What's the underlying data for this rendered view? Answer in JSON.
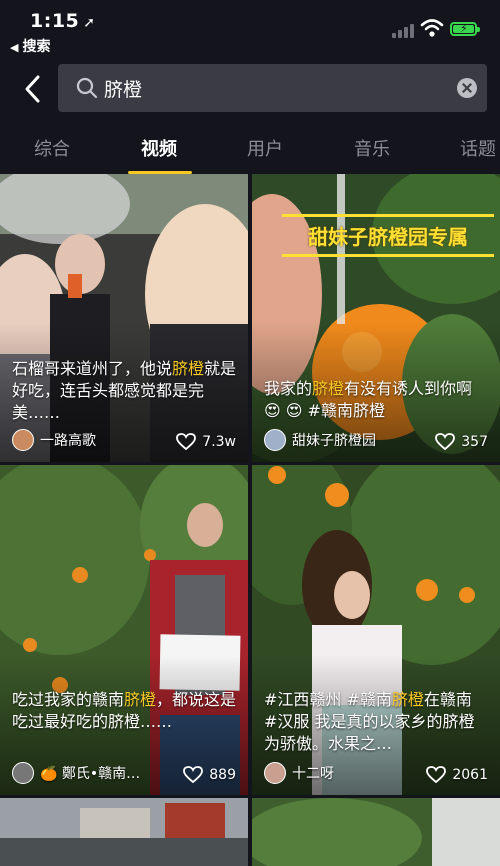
{
  "status": {
    "time": "1:15",
    "back_app": "搜索"
  },
  "search": {
    "query": "脐橙"
  },
  "tabs": [
    "综合",
    "视频",
    "用户",
    "音乐",
    "话题"
  ],
  "active_tab": "视频",
  "videos": [
    {
      "caption_pre": "石榴哥来道州了，他说",
      "caption_hl1": "脐",
      "caption_mid": "",
      "caption_hl2": "橙",
      "caption_post": "就是好吃，连舌头都感觉都是完美……",
      "author": "一路高歌",
      "likes": "7.3w"
    },
    {
      "overlay": "甜妹子脐橙园专属",
      "caption_pre": "我家的",
      "caption_hl1": "脐橙",
      "caption_post": "有没有诱人到你啊 😍 😍 #赣南脐橙",
      "author": "甜妹子脐橙园",
      "likes": "357"
    },
    {
      "caption_pre": "吃过我家的赣南",
      "caption_hl1": "脐橙",
      "caption_post": "，都说这是吃过最好吃的脐橙……",
      "author": "🍊 鄭氏•赣南…",
      "likes": "889"
    },
    {
      "caption_pre": "#江西赣州 #赣南",
      "caption_hl1": "脐橙",
      "caption_post": "在赣南 #汉服 我是真的以家乡的脐橙为骄傲。水果之…",
      "author": "十二呀",
      "likes": "2061"
    }
  ],
  "colors": {
    "background": "#14151c",
    "accent": "#f6c826",
    "search_bg": "#3a3b43",
    "battery": "#3ad64d"
  }
}
